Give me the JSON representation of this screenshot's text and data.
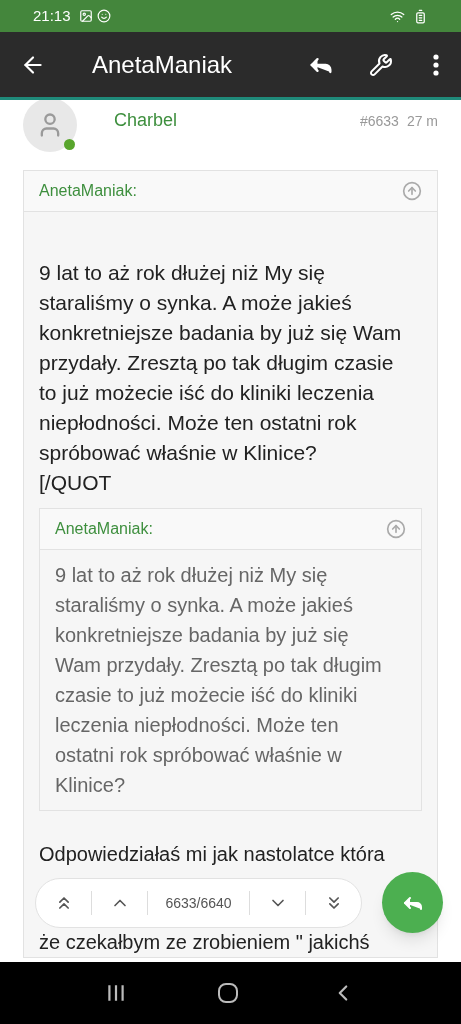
{
  "status_bar": {
    "time": "21:13"
  },
  "app_bar": {
    "title": "AnetaManiak"
  },
  "post": {
    "author": "Charbel",
    "online": true,
    "number": "#6633",
    "time": "27 m",
    "quote": {
      "author": "AnetaManiak:",
      "text": "9 lat to aż rok dłużej niż My się staraliśmy o synka. A może jakieś konkretniejsze badania by już się Wam przydały. Zresztą po tak długim czasie to już możecie iść do kliniki leczenia niepłodności. Może ten ostatni rok spróbować właśnie w Klinice?",
      "trailing": "[/QUOT",
      "nested_quote": {
        "author": "AnetaManiak:",
        "text": "9 lat to aż rok dłużej niż My się staraliśmy o synka. A może jakieś konkretniejsze badania by już się Wam przydały. Zresztą po tak długim czasie to już możecie iść do kliniki leczenia niepłodności. Może ten ostatni rok spróbować właśnie w Klinice?"
      }
    },
    "reply_lines": [
      "Odpowiedziałaś mi jak nastolatce która",
      "że czekałbym ze zrobieniem \" jakichś"
    ]
  },
  "navigator": {
    "position": "6633/6640"
  }
}
